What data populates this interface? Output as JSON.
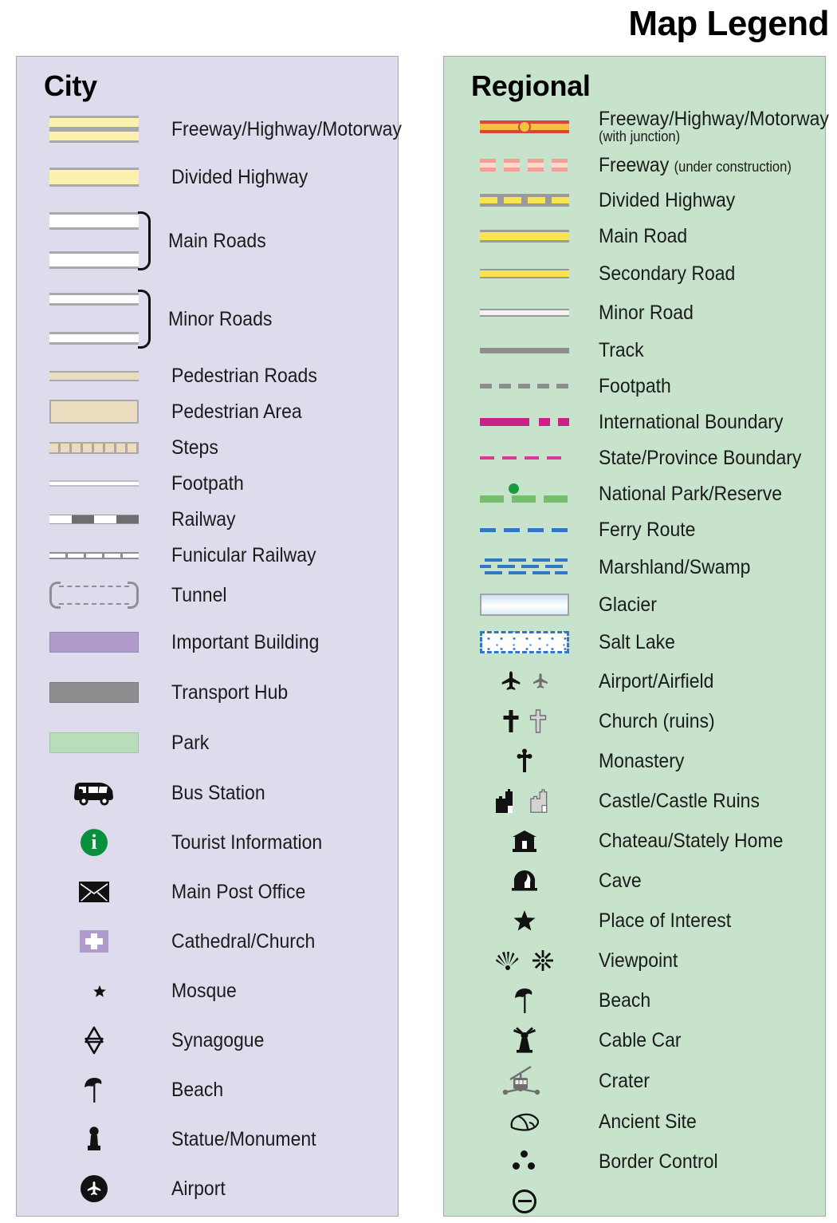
{
  "title": "Map Legend",
  "city": {
    "heading": "City",
    "bg": "#dedcec",
    "items": [
      {
        "symbol": "freeway-dual-band",
        "label": "Freeway/Highway/Motorway"
      },
      {
        "symbol": "divided-highway-band",
        "label": "Divided Highway"
      },
      {
        "symbol": "main-road-band",
        "label": ""
      },
      {
        "symbol": "main-road-band",
        "label": "Main Roads",
        "grouped": true
      },
      {
        "symbol": "minor-road-band",
        "label": ""
      },
      {
        "symbol": "minor-road-band",
        "label": "Minor Roads",
        "grouped": true
      },
      {
        "symbol": "pedestrian-road-band",
        "label": "Pedestrian Roads"
      },
      {
        "symbol": "pedestrian-area-box",
        "label": "Pedestrian Area"
      },
      {
        "symbol": "steps-pattern",
        "label": "Steps"
      },
      {
        "symbol": "footpath-line",
        "label": "Footpath"
      },
      {
        "symbol": "railway-line",
        "label": "Railway"
      },
      {
        "symbol": "funicular-line",
        "label": "Funicular Railway"
      },
      {
        "symbol": "tunnel-brackets",
        "label": "Tunnel"
      },
      {
        "symbol": "important-building-box",
        "label": "Important Building"
      },
      {
        "symbol": "transport-hub-box",
        "label": "Transport Hub"
      },
      {
        "symbol": "park-box",
        "label": "Park"
      },
      {
        "symbol": "bus-icon",
        "label": "Bus Station"
      },
      {
        "symbol": "information-icon",
        "label": "Tourist Information"
      },
      {
        "symbol": "envelope-icon",
        "label": "Main Post Office"
      },
      {
        "symbol": "church-cross-icon",
        "label": "Cathedral/Church"
      },
      {
        "symbol": "crescent-star-icon",
        "label": "Mosque"
      },
      {
        "symbol": "star-of-david-icon",
        "label": "Synagogue"
      },
      {
        "symbol": "parasol-icon",
        "label": "Beach"
      },
      {
        "symbol": "statue-icon",
        "label": "Statue/Monument"
      },
      {
        "symbol": "airplane-circle-icon",
        "label": "Airport"
      }
    ],
    "brace_labels": [
      "Main Roads",
      "Minor Roads"
    ]
  },
  "regional": {
    "heading": "Regional",
    "bg": "#c7e3cc",
    "items": [
      {
        "symbol": "freeway-junction-line",
        "label": "Freeway/Highway/Motorway",
        "sub": "(with junction)"
      },
      {
        "symbol": "freeway-dashed-line",
        "label": "Freeway",
        "inline": "(under construction)"
      },
      {
        "symbol": "divided-highway-line",
        "label": "Divided Highway"
      },
      {
        "symbol": "main-road-line",
        "label": "Main Road"
      },
      {
        "symbol": "secondary-road-line",
        "label": "Secondary Road"
      },
      {
        "symbol": "minor-road-line",
        "label": "Minor Road"
      },
      {
        "symbol": "track-line",
        "label": "Track"
      },
      {
        "symbol": "footpath-dashed-line",
        "label": "Footpath"
      },
      {
        "symbol": "intl-boundary-line",
        "label": "International Boundary"
      },
      {
        "symbol": "state-boundary-line",
        "label": "State/Province Boundary"
      },
      {
        "symbol": "national-park-line",
        "label": "National Park/Reserve"
      },
      {
        "symbol": "ferry-route-line",
        "label": "Ferry Route"
      },
      {
        "symbol": "marshland-pattern",
        "label": "Marshland/Swamp"
      },
      {
        "symbol": "glacier-box",
        "label": "Glacier"
      },
      {
        "symbol": "salt-lake-box",
        "label": "Salt Lake"
      },
      {
        "symbol": "airplane-pair-icon",
        "label": "Airport/Airfield"
      },
      {
        "symbol": "cross-pair-icon",
        "label": "Church (ruins)"
      },
      {
        "symbol": "orthodox-cross-icon",
        "label": "Monastery"
      },
      {
        "symbol": "castle-pair-icon",
        "label": "Castle/Castle Ruins"
      },
      {
        "symbol": "chateau-icon",
        "label": "Chateau/Stately Home"
      },
      {
        "symbol": "cave-icon",
        "label": "Cave"
      },
      {
        "symbol": "star-icon",
        "label": "Place of Interest"
      },
      {
        "symbol": "viewpoint-pair-icon",
        "label": "Viewpoint"
      },
      {
        "symbol": "parasol-icon",
        "label": "Beach"
      },
      {
        "symbol": "windmill-icon",
        "label": "Windmill"
      },
      {
        "symbol": "cable-car-icon",
        "label": "Cable Car"
      },
      {
        "symbol": "crater-icon",
        "label": "Crater"
      },
      {
        "symbol": "ancient-site-icon",
        "label": "Ancient Site"
      },
      {
        "symbol": "border-control-icon",
        "label": "Border Control"
      }
    ]
  },
  "colors": {
    "city_panel": "#dedcec",
    "regional_panel": "#c7e3cc",
    "road_yellow": "#fbf2ae",
    "regional_yellow": "#f7e44f",
    "freeway_red": "#d9453c",
    "freeway_orange": "#f6c13f",
    "boundary_magenta": "#cc2288",
    "park_green": "#77bd6e",
    "water_blue": "#2f77c4",
    "important_building": "#b09ccc",
    "pedestrian_beige": "#ebdcc0",
    "park_fill": "#b8ddb8",
    "transport_hub_grey": "#8d8d8d",
    "info_green": "#0a8f3c"
  }
}
